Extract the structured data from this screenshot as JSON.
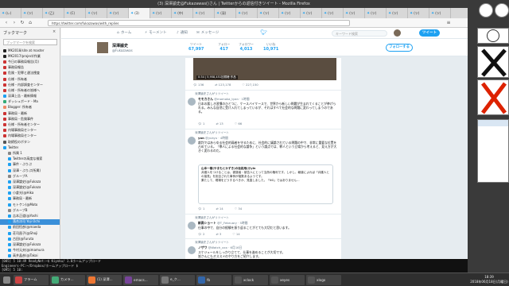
{
  "window": {
    "title": "(3) 深澤諭史@Fukazawas()さん | Twitterからの返信付きツイート - Mozilla Firefox",
    "url": "https://twitter.com/fukazawas/with_replies",
    "tabs": [
      "(レ)",
      "(ツ)",
      "(乙)",
      "(C)",
      "(ツ)",
      "(ツ)",
      "(3)",
      "(ツ)",
      "(中)",
      "(ツ)",
      "(深)",
      "(ツ)",
      "(ツ)",
      "(ツ)",
      "(ツ)",
      "(ツ)",
      "(ツ)",
      "(ツ)",
      "(ツ)",
      "(ツ)",
      "(ツ)"
    ]
  },
  "sidebar": {
    "title": "ブックマーク",
    "search_placeholder": "ブックマークを検索",
    "items": [
      {
        "label": "MK2018/site at master",
        "color": "#222",
        "sel": false
      },
      {
        "label": "MK2017/project/作業",
        "color": "#222",
        "sel": false
      },
      {
        "label": "今日の事務局報告(月)",
        "color": "#c33",
        "sel": false
      },
      {
        "label": "事務局報告",
        "color": "#c33",
        "sel": false
      },
      {
        "label": "危険・犯罪と違法捜査",
        "color": "#c33",
        "sel": false
      },
      {
        "label": "仕様・所有者",
        "color": "#c33",
        "sel": false
      },
      {
        "label": "仕様・内部調査センター",
        "color": "#c33",
        "sel": false
      },
      {
        "label": "仕様・所有者の皆様へ",
        "color": "#c33",
        "sel": false
      },
      {
        "label": "深澤上告・最新情報",
        "color": "#1da1f2",
        "sel": false
      },
      {
        "label": "ダッシュボード - Ma",
        "color": "#3a7",
        "sel": false
      },
      {
        "label": "Blogger: 所有者",
        "color": "#e86",
        "sel": false
      },
      {
        "label": "事務局・最新",
        "color": "#c33",
        "sel": false
      },
      {
        "label": "事務局・危険事件",
        "color": "#c33",
        "sel": false
      },
      {
        "label": "仕様・所有者センター",
        "color": "#c33",
        "sel": false
      },
      {
        "label": "内場事務局センター",
        "color": "#c33",
        "sel": false
      },
      {
        "label": "内場事務局センター",
        "color": "#c33",
        "sel": false
      },
      {
        "label": "取締役のボタン",
        "color": "#555",
        "sel": false
      },
      {
        "label": "Twitter",
        "color": "#1da1f2",
        "sel": false
      },
      {
        "label": "所属 1",
        "color": "#888",
        "sel": false
      },
      {
        "label": "Twitterの高度な検索",
        "color": "#1da1f2",
        "sel": false
      },
      {
        "label": "事件・ぷりぷ",
        "color": "#1da1f2",
        "sel": false
      },
      {
        "label": "深澤・ぷりぷ(所属)",
        "color": "#1da1f2",
        "sel": false
      },
      {
        "label": "グループA",
        "color": "#888",
        "sel": false
      },
      {
        "label": "深澤論史(@Fukaza",
        "color": "#1da1f2",
        "sel": false
      },
      {
        "label": "深澤論史(@Fukaza",
        "color": "#1da1f2",
        "sel": false
      },
      {
        "label": "小倉光(@Hika",
        "color": "#1da1f2",
        "sel": false
      },
      {
        "label": "事務局・最新",
        "color": "#1da1f2",
        "sel": false
      },
      {
        "label": "モトケン(@Moto",
        "color": "#1da1f2",
        "sel": false
      },
      {
        "label": "グループB",
        "color": "#888",
        "sel": false
      },
      {
        "label": "吉本正道(@Yoshi",
        "color": "#1da1f2",
        "sel": false
      },
      {
        "label": "落合洋司 Yoji Ochi",
        "color": "#1da1f2",
        "sel": true
      },
      {
        "label": "前田恒彦(@maeda",
        "color": "#1da1f2",
        "sel": false
      },
      {
        "label": "荘司昌子(@Shoji",
        "color": "#1da1f2",
        "sel": false
      },
      {
        "label": "古田(@Furuta",
        "color": "#1da1f2",
        "sel": false
      },
      {
        "label": "深澤論史(@Fukaza",
        "color": "#1da1f2",
        "sel": false
      },
      {
        "label": "今村元夫(@imamura",
        "color": "#1da1f2",
        "sel": false
      },
      {
        "label": "高井晶彦(@Takai",
        "color": "#1da1f2",
        "sel": false
      },
      {
        "label": "所属・事件(@Ito",
        "color": "#1da1f2",
        "sel": false
      },
      {
        "label": "池田(@Ikeda",
        "color": "#1da1f2",
        "sel": false
      },
      {
        "label": "猪木 真(@NOB",
        "color": "#1da1f2",
        "sel": false
      }
    ]
  },
  "twitter": {
    "nav": [
      "ホーム",
      "モーメント",
      "通知",
      "メッセージ"
    ],
    "search_placeholder": "キーワード検索",
    "tweet_button": "ツイート",
    "profile": {
      "name": "深澤諭史",
      "handle": "@Fukazawas"
    },
    "stats": [
      {
        "label": "ツイート",
        "value": "67,997"
      },
      {
        "label": "フォロー",
        "value": "417"
      },
      {
        "label": "フォロワー",
        "value": "4,013"
      },
      {
        "label": "いいね",
        "value": "10,971"
      }
    ],
    "follow_button": "フォローする",
    "media_caption": "0:34 | 5,958,451回視聴 作品",
    "media_actions": [
      "136",
      "123,178",
      "227,150"
    ],
    "tweets": [
      {
        "rt": "深澤諭史さんがリツイート",
        "name": "モモカさん",
        "handle": "@momoka_tyan · 1時間",
        "body": "日本の悪しき習慣のひとつに、ケースバイケースで、世界から新しい問題が生まれてくることが挙げられる。みんな自然に受け入れてしまっているが、それはすべて社会的な問題に変わってしまうのである。",
        "actions": [
          "1",
          "13",
          "66"
        ]
      },
      {
        "rt": "深澤諭史さんがリツイート",
        "name": "yon",
        "handle": "@yukyu · 4時間",
        "body": "裁判ではあらゆる社会的弱者を守るために、社会的に議論されている問題の中で、非常に重要な位置を占めている。「罪人による社会的な論争」という論点では、罪人という立場から考えると、見え方が大きく変わるのだ。",
        "quote_title": "山本一樹(やまもとかずき)の仮説用(@yin",
        "quote_body": "弁護人をつけることは、被疑者・被告人にとって当然の権利です。しかし、報道によれば「弁護人との接見」を拒否された事例が複数あるようです。",
        "quote_more": "果たして、現場をどうするべきか、見直しました。「NG」ではありません…",
        "actions": [
          "1",
          "14",
          "34"
        ]
      },
      {
        "rt": "深澤諭史さんがリツイート",
        "name": "新高ショート",
        "handle": "@T_February · 5時間",
        "body": "仕事の中で、自分の経験を振り返ることがとても大切だと思います。",
        "actions": [
          "2",
          "3",
          "14"
        ]
      },
      {
        "rt": "深澤諭史さんがリツイート",
        "name": "ノザワ",
        "handle": "@Watch_xxx · 6月16日",
        "body": "スケジュールをしっかり立てて、仕事を進めることが大切です。\n皆さんにもオススメのやり方をご紹介します。\nルールは簡単！",
        "actions": [
          "3",
          "10",
          "18"
        ]
      }
    ]
  },
  "terminal": [
    "[085] 5 10:49 ReadyNet:~$ Kiyoku/ 1.0ホームアップロード",
    "Engineers-PC:~/Dropbox/ホームアップロード $",
    "[095] 5 10:"
  ],
  "taskbar": {
    "items": [
      {
        "label": "フラーム",
        "color": "#c44"
      },
      {
        "label": "カメラ...",
        "color": "#4a7"
      },
      {
        "label": "(1) 深澤...",
        "color": "#e73"
      },
      {
        "label": "emacs...",
        "color": "#749"
      },
      {
        "label": "e_ク...",
        "color": "#777"
      },
      {
        "label": "fb",
        "color": "#36a"
      },
      {
        "label": "xclock",
        "color": "#555"
      },
      {
        "label": "xeyes",
        "color": "#555"
      },
      {
        "label": "xlogo",
        "color": "#555"
      }
    ],
    "clock_time": "18:39",
    "clock_date": "2018年06月18日(月曜日)"
  }
}
